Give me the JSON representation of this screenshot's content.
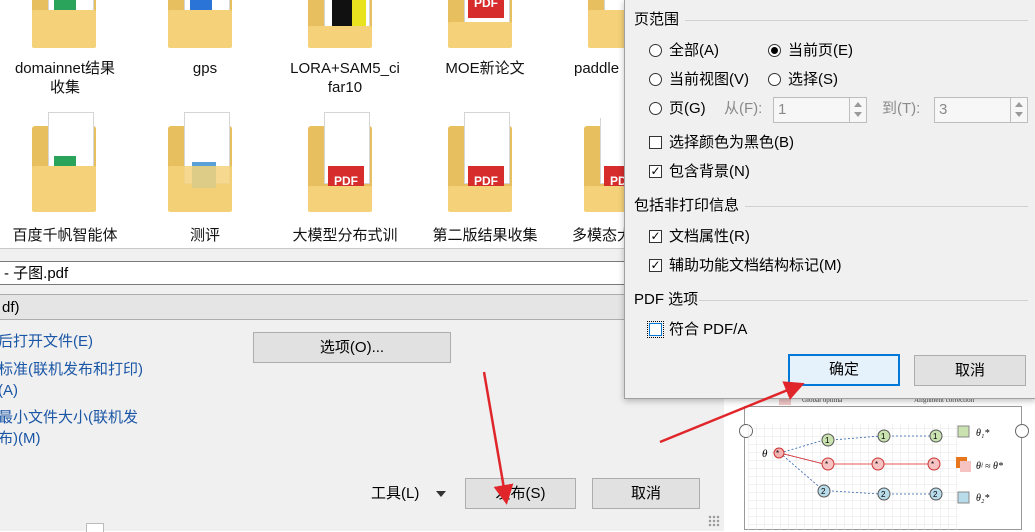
{
  "explorer": {
    "row1": [
      {
        "label": "domainnet结果\n收集"
      },
      {
        "label": "gps"
      },
      {
        "label": "LORA+SAM5_ci\nfar10"
      },
      {
        "label": "MOE新论文"
      },
      {
        "label": "paddle"
      }
    ],
    "row2": [
      {
        "label": "百度千帆智能体"
      },
      {
        "label": "测评"
      },
      {
        "label": "大模型分布式训"
      },
      {
        "label": "第二版结果收集"
      },
      {
        "label": "多模态大"
      }
    ],
    "pdf_badge": "PDF"
  },
  "save_dialog": {
    "filename_value": "- 子图.pdf",
    "filetype_value": "df)",
    "open_after_publish": "后打开文件(E)",
    "standard_option": "标准(联机发布和打印)\n(A)",
    "min_size_option": "最小文件大小(联机发\n布)(M)",
    "options_button": "选项(O)...",
    "tools_label": "工具(L)",
    "publish_button": "发布(S)",
    "cancel_button": "取消"
  },
  "options_popup": {
    "page_range_title": "页范围",
    "all": "全部(A)",
    "current_page": "当前页(E)",
    "current_view": "当前视图(V)",
    "selection": "选择(S)",
    "pages": "页(G)",
    "from_label": "从(F):",
    "from_value": "1",
    "to_label": "到(T):",
    "to_value": "3",
    "black_color": "选择颜色为黑色(B)",
    "include_bg": "包含背景(N)",
    "non_print_title": "包括非打印信息",
    "doc_props": "文档属性(R)",
    "accessibility_tags": "辅助功能文档结构标记(M)",
    "pdf_options_title": "PDF 选项",
    "pdfa": "符合 PDF/A",
    "ok_button": "确定",
    "cancel_button": "取消"
  },
  "preview": {
    "legend1": "Global optima",
    "legend2": "Alignment correction",
    "theta": "θ",
    "theta1": "θ₁*",
    "theta_eq": "θʲ ≈ θ*",
    "theta2": "θ₂*",
    "node1": "1",
    "node2": "2",
    "node_star": "*"
  },
  "colors": {
    "annotation_arrow": "#e0262b",
    "accent": "#0078d7",
    "link": "#1a56a6"
  }
}
